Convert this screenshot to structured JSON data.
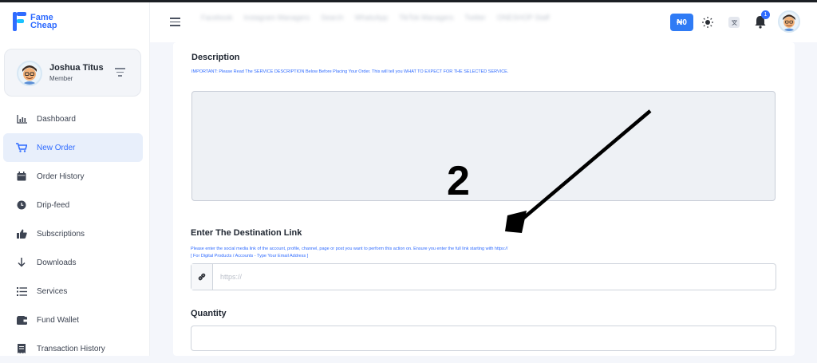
{
  "app": {
    "brand_line1": "Fame",
    "brand_line2": "Cheap"
  },
  "user": {
    "name": "Joshua Titus",
    "role": "Member"
  },
  "sidebar": {
    "items": [
      {
        "label": "Dashboard",
        "icon": "chart-icon"
      },
      {
        "label": "New Order",
        "icon": "cart-icon",
        "active": true
      },
      {
        "label": "Order History",
        "icon": "calendar-icon"
      },
      {
        "label": "Drip-feed",
        "icon": "clock-icon"
      },
      {
        "label": "Subscriptions",
        "icon": "thumbs-up-icon"
      },
      {
        "label": "Downloads",
        "icon": "arrow-down-icon"
      },
      {
        "label": "Services",
        "icon": "list-icon"
      },
      {
        "label": "Fund Wallet",
        "icon": "wallet-icon"
      },
      {
        "label": "Transaction History",
        "icon": "receipt-icon"
      }
    ]
  },
  "topbar": {
    "balance": "₦0",
    "notification_count": "1",
    "blurred_items": [
      "Facebook",
      "Instagram Managers",
      "Search",
      "WhatsApp",
      "TikTok Managers",
      "Twitter",
      "ONESHOP Staff"
    ]
  },
  "form": {
    "description_heading": "Description",
    "description_note": "IMPORTANT: Please Read The SERVICE DESCRIPTION Below Before Placing Your Order. This will tell you WHAT TO EXPECT FOR THE SELECTED SERVICE.",
    "description_value": "",
    "link_heading": "Enter The Destination Link",
    "link_note": "Please enter the social media link of the account, profile, channel, page or post you want to perform this action on. Ensure you enter the full link starting with https://",
    "link_note2": "[ For Digital Products / Accounts - Type Your Email Address ]",
    "link_placeholder": "https://",
    "quantity_heading": "Quantity",
    "quantity_value": ""
  },
  "annotation": {
    "number": "2"
  },
  "colors": {
    "accent": "#2f6bff",
    "active_bg": "#e8effb",
    "balance_bg": "#2f7bf5"
  }
}
